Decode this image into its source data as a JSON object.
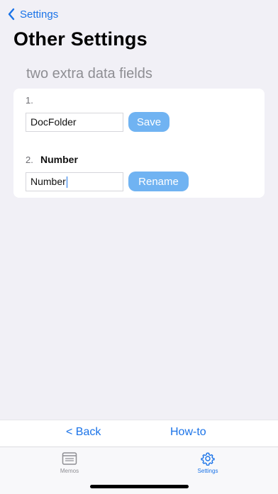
{
  "nav": {
    "back_label": "Settings"
  },
  "page": {
    "title": "Other Settings"
  },
  "section": {
    "header": "two extra data fields"
  },
  "fields": [
    {
      "number": "1.",
      "name": "",
      "value": "DocFolder",
      "button": "Save"
    },
    {
      "number": "2.",
      "name": "Number",
      "value": "Number",
      "button": "Rename"
    }
  ],
  "bottom_links": {
    "back": "< Back",
    "howto": "How-to"
  },
  "tabs": [
    {
      "label": "Memos",
      "icon": "memo-list-icon",
      "active": false
    },
    {
      "label": "Settings",
      "icon": "gear-icon",
      "active": true
    }
  ],
  "colors": {
    "accent": "#1a73e8",
    "button_fill": "#70b3f2",
    "inactive_tab": "#8e8e93"
  }
}
